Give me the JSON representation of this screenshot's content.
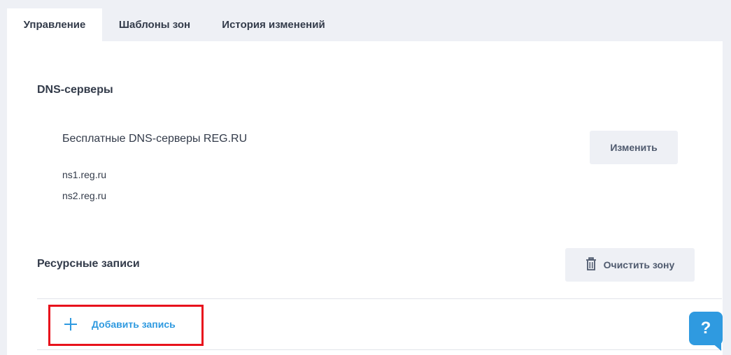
{
  "tabs": [
    {
      "label": "Управление",
      "active": true
    },
    {
      "label": "Шаблоны зон",
      "active": false
    },
    {
      "label": "История изменений",
      "active": false
    }
  ],
  "dns": {
    "title": "DNS-серверы",
    "name": "Бесплатные DNS-серверы REG.RU",
    "servers": [
      "ns1.reg.ru",
      "ns2.reg.ru"
    ],
    "change_label": "Изменить"
  },
  "records": {
    "title": "Ресурсные записи",
    "clear_label": "Очистить зону",
    "add_label": "Добавить запись"
  },
  "help": {
    "label": "?"
  },
  "colors": {
    "accent": "#2f9ae0",
    "highlight": "#e8121c",
    "background": "#eef0f5"
  },
  "icons": {
    "clear": "trash-icon",
    "add": "plus-icon",
    "help": "help-icon"
  }
}
